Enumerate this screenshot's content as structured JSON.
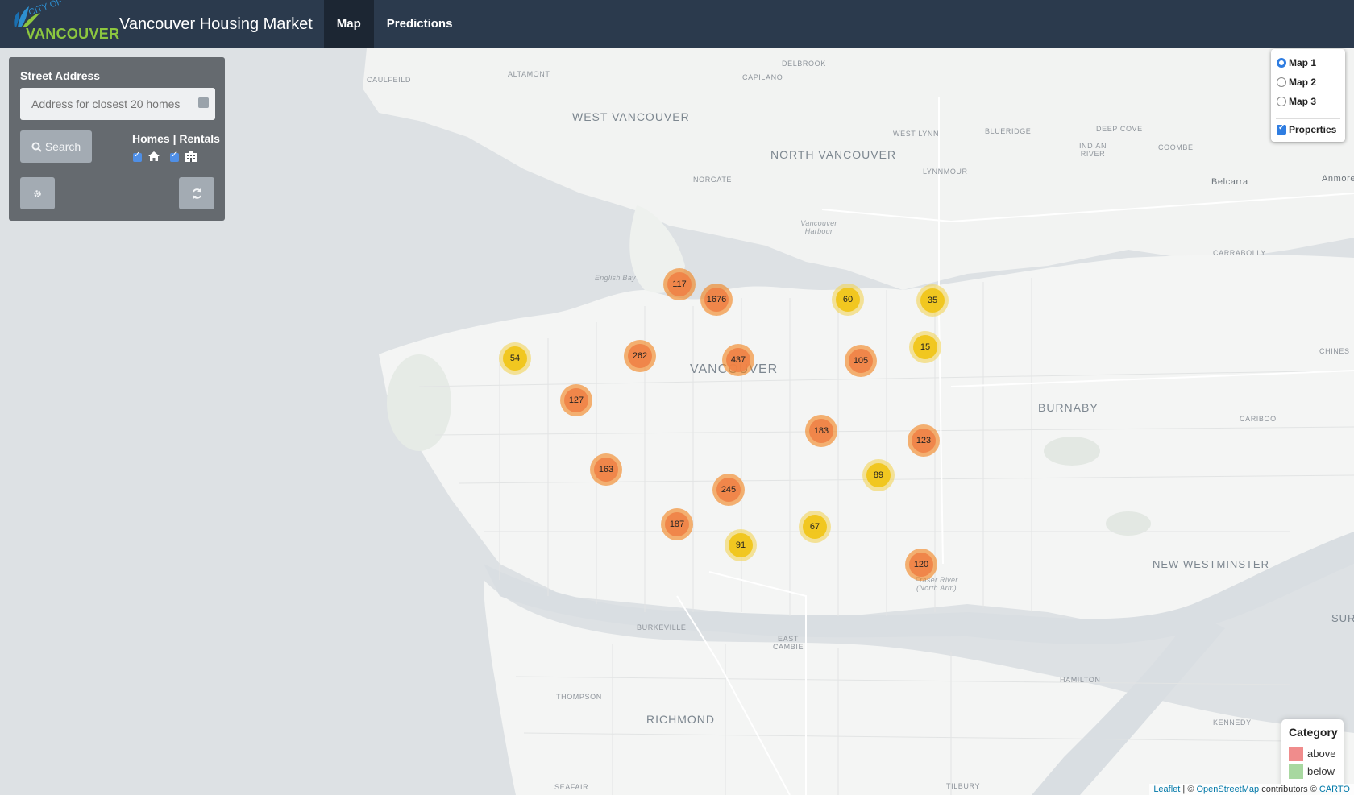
{
  "navbar": {
    "logo_top": "CITY OF",
    "logo_bottom": "VANCOUVER",
    "title": "Vancouver Housing Market",
    "tabs": [
      {
        "label": "Map",
        "active": true
      },
      {
        "label": "Predictions",
        "active": false
      }
    ]
  },
  "panel": {
    "street_label": "Street Address",
    "address_placeholder": "Address for closest 20 homes",
    "search_label": "Search",
    "homes_rentals_label": "Homes | Rentals",
    "homes_checked": true,
    "rentals_checked": true
  },
  "layers": {
    "maps": [
      {
        "label": "Map 1",
        "selected": true
      },
      {
        "label": "Map 2",
        "selected": false
      },
      {
        "label": "Map 3",
        "selected": false
      }
    ],
    "overlay_label": "Properties",
    "overlay_checked": true
  },
  "legend": {
    "title": "Category",
    "items": [
      {
        "label": "above",
        "color": "#f08c8c"
      },
      {
        "label": "below",
        "color": "#a8d8a0"
      }
    ]
  },
  "attribution": {
    "leaflet": "Leaflet",
    "sep": " | © ",
    "osm": "OpenStreetMap",
    "contrib": " contributors © ",
    "carto": "CARTO"
  },
  "map_labels": {
    "west_vancouver": "WEST VANCOUVER",
    "north_vancouver": "NORTH VANCOUVER",
    "vancouver": "VANCOUVER",
    "burnaby": "BURNABY",
    "new_westminster": "NEW WESTMINSTER",
    "richmond": "RICHMOND",
    "caulfeild": "CAULFEILD",
    "altamont": "ALTAMONT",
    "delbrook": "DELBROOK",
    "capilano": "CAPILANO",
    "west_lynn": "WEST LYNN",
    "blueridge": "BLUERIDGE",
    "deep_cove": "DEEP COVE",
    "indian_river": "INDIAN RIVER",
    "coombe": "COOMBE",
    "norgate": "NORGATE",
    "lynnmour": "LYNNMOUR",
    "belcarra": "Belcarra",
    "anmore": "Anmore",
    "carrabolly": "CARRABOLLY",
    "chines": "CHINES",
    "cariboo": "CARIBOO",
    "burkeville": "BURKEVILLE",
    "east_cambie": "EAST CAMBIE",
    "thompson": "THOMPSON",
    "hamilton": "HAMILTON",
    "kennedy": "KENNEDY",
    "seafair": "SEAFAIR",
    "tilbury": "TILBURY",
    "sur": "SUR",
    "english_bay": "English Bay",
    "vancouver_harbour": "Vancouver Harbour",
    "fraser_river": "Fraser River (North Arm)"
  },
  "clusters": [
    {
      "count": "117",
      "category": "above"
    },
    {
      "count": "1676",
      "category": "above"
    },
    {
      "count": "60",
      "category": "below"
    },
    {
      "count": "35",
      "category": "below"
    },
    {
      "count": "54",
      "category": "below"
    },
    {
      "count": "262",
      "category": "above"
    },
    {
      "count": "437",
      "category": "above"
    },
    {
      "count": "105",
      "category": "above"
    },
    {
      "count": "15",
      "category": "below"
    },
    {
      "count": "127",
      "category": "above"
    },
    {
      "count": "183",
      "category": "above"
    },
    {
      "count": "123",
      "category": "above"
    },
    {
      "count": "163",
      "category": "above"
    },
    {
      "count": "89",
      "category": "below"
    },
    {
      "count": "245",
      "category": "above"
    },
    {
      "count": "187",
      "category": "above"
    },
    {
      "count": "67",
      "category": "below"
    },
    {
      "count": "91",
      "category": "below"
    },
    {
      "count": "120",
      "category": "above"
    }
  ]
}
